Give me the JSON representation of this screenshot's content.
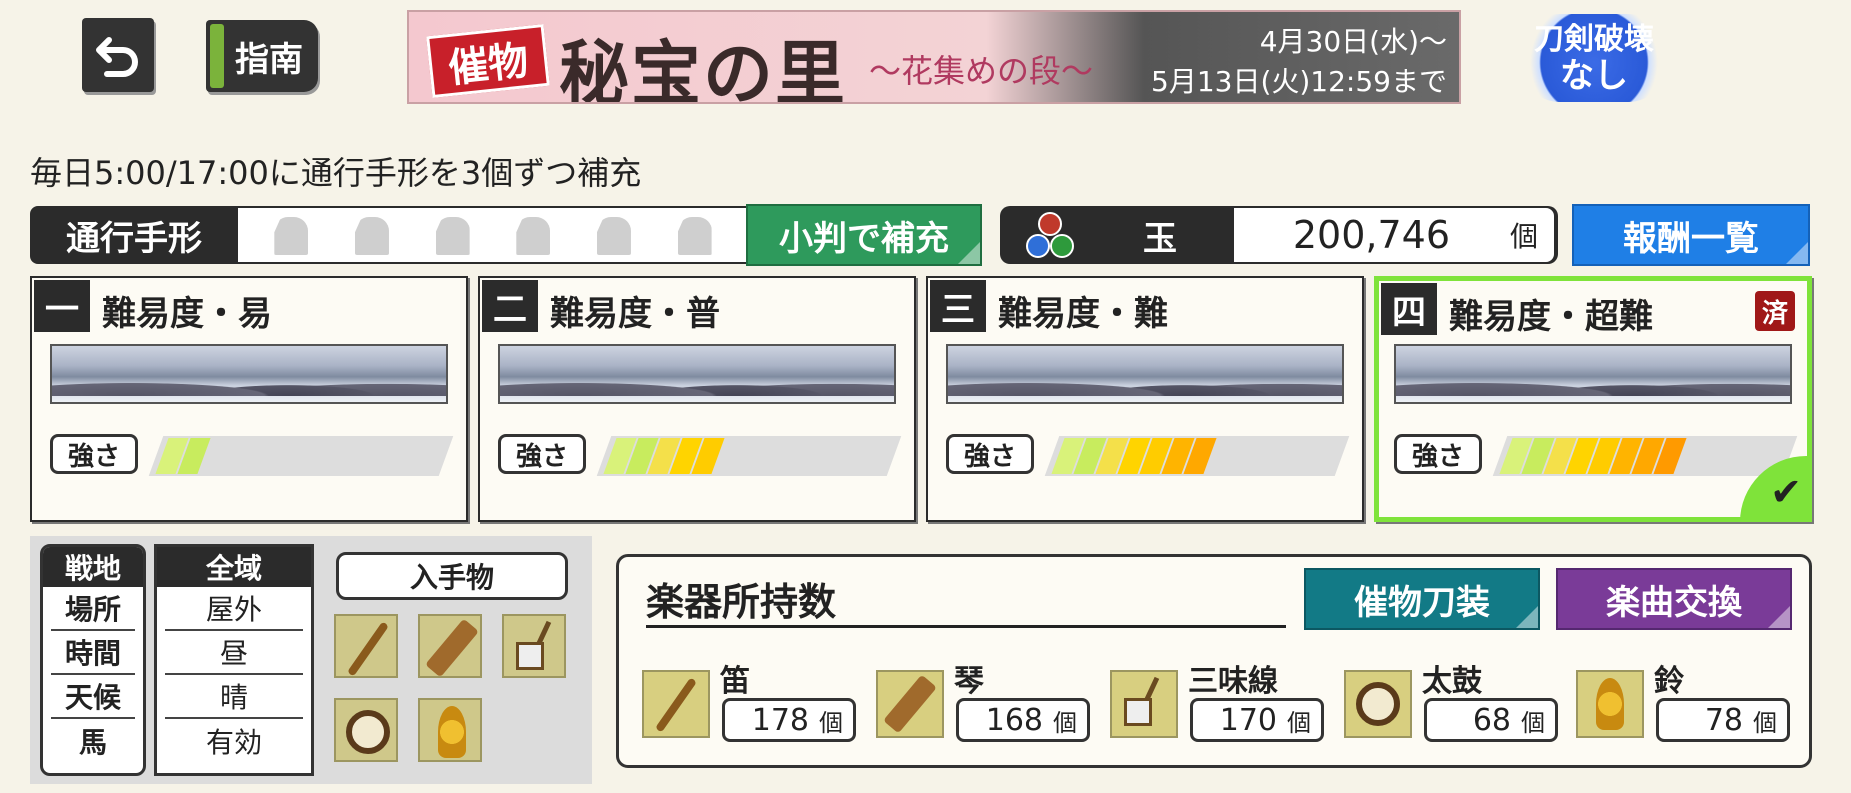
{
  "header": {
    "back_icon": "return-arrow-icon",
    "guide_label": "指南",
    "banner": {
      "tag": "催物",
      "title": "秘宝の里",
      "subtitle": "〜花集めの段〜",
      "date_start": "4月30日(水)〜",
      "date_end": "5月13日(火)12:59まで"
    },
    "no_break": {
      "line1": "刀剣破壊",
      "line2": "なし"
    }
  },
  "notice": "毎日5:00/17:00に通行手形を3個ずつ補充",
  "pass": {
    "label": "通行手形",
    "slots": 6,
    "refill_label": "小判で補充"
  },
  "orb": {
    "label": "玉",
    "value": "200,746",
    "unit": "個"
  },
  "rewards_label": "報酬一覧",
  "difficulties": [
    {
      "num": "一",
      "name": "難易度・易",
      "strength": "強さ",
      "level": 2
    },
    {
      "num": "二",
      "name": "難易度・普",
      "strength": "強さ",
      "level": 5
    },
    {
      "num": "三",
      "name": "難易度・難",
      "strength": "強さ",
      "level": 7
    },
    {
      "num": "四",
      "name": "難易度・超難",
      "strength": "強さ",
      "level": 8,
      "done": "済",
      "selected": true
    }
  ],
  "conditions": {
    "labels": [
      "戦地",
      "場所",
      "時間",
      "天候",
      "馬"
    ],
    "values": [
      "全域",
      "屋外",
      "昼",
      "晴",
      "有効"
    ]
  },
  "loot": {
    "label": "入手物",
    "icons": [
      "flute-icon",
      "koto-icon",
      "shamisen-icon",
      "taiko-drum-icon",
      "suzu-bell-icon"
    ]
  },
  "instruments": {
    "title": "楽器所持数",
    "event_button": "催物刀装",
    "music_button": "楽曲交換",
    "items": [
      {
        "name": "笛",
        "count": "178",
        "unit": "個"
      },
      {
        "name": "琴",
        "count": "168",
        "unit": "個"
      },
      {
        "name": "三味線",
        "count": "170",
        "unit": "個"
      },
      {
        "name": "太鼓",
        "count": "68",
        "unit": "個"
      },
      {
        "name": "鈴",
        "count": "78",
        "unit": "個"
      }
    ]
  },
  "colors": {
    "green_button": "#2e9a5c",
    "blue_button": "#1f7fe6",
    "teal_button": "#127a86",
    "purple_button": "#7a3b98",
    "selected_border": "#7fe33a",
    "done_badge": "#a01818"
  }
}
